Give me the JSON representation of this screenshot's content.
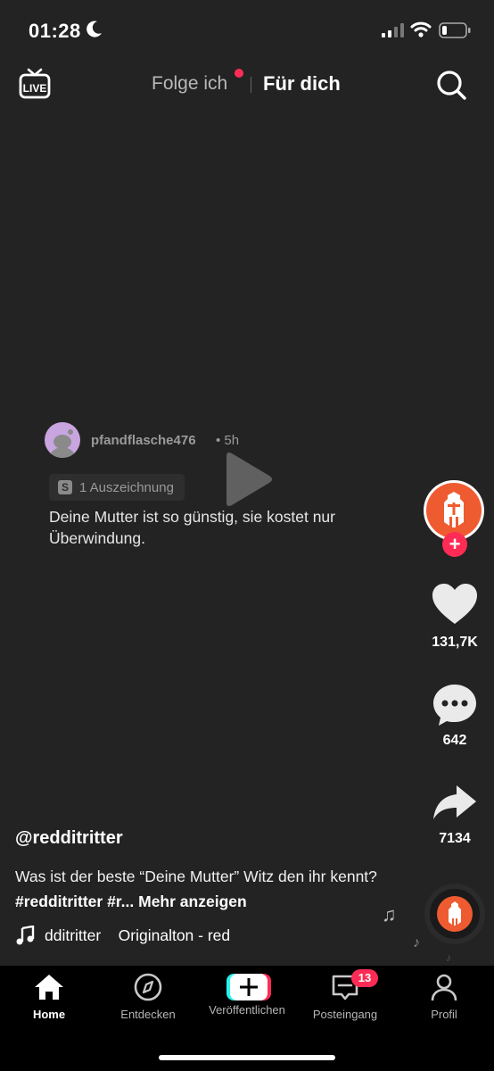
{
  "status_bar": {
    "time": "01:28"
  },
  "top_nav": {
    "live_label": "LIVE",
    "tab_following": "Folge ich",
    "tab_for_you": "Für dich"
  },
  "post": {
    "username": "pfandflasche476",
    "time": "• 5h",
    "award_icon_letter": "S",
    "award": "1 Auszeichnung",
    "text": "Deine Mutter ist so günstig, sie kostet nur Überwindung."
  },
  "actions": {
    "likes": "131,7K",
    "comments": "642",
    "shares": "7134"
  },
  "caption": {
    "handle": "@redditritter",
    "text": "Was ist der beste “Deine Mutter” Witz den ihr kennt?",
    "hashtags": "#redditritter #r...",
    "more": "Mehr anzeigen",
    "sound": "dditritter    Originalton - red"
  },
  "bottom_nav": {
    "home": "Home",
    "discover": "Entdecken",
    "publish": "Veröffentlichen",
    "inbox": "Posteingang",
    "inbox_badge": "13",
    "profile": "Profil"
  },
  "colors": {
    "accent": "#fe2c55",
    "background": "#232323",
    "brand_orange": "#ef5b30"
  }
}
